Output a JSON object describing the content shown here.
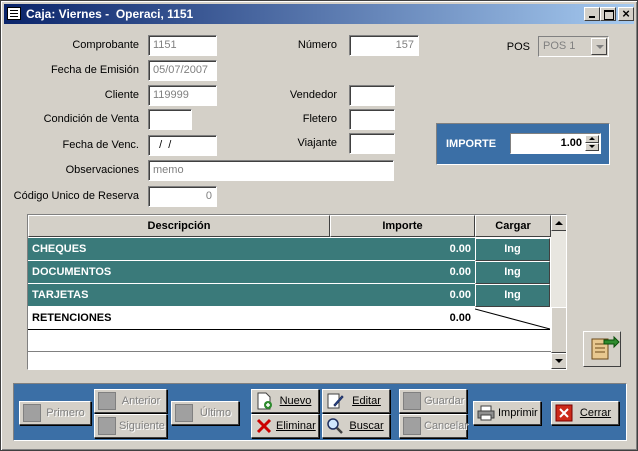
{
  "window": {
    "title": "Caja: Viernes -  Operaci, 1151"
  },
  "form": {
    "comprobante": {
      "label": "Comprobante",
      "value": "1151"
    },
    "fecha_emision": {
      "label": "Fecha de Emisión",
      "value": "05/07/2007"
    },
    "cliente": {
      "label": "Cliente",
      "value": "119999"
    },
    "condicion_venta": {
      "label": "Condición de Venta",
      "value": ""
    },
    "fecha_venc": {
      "label": "Fecha de Venc.",
      "value": "  /  /"
    },
    "observaciones": {
      "label": "Observaciones",
      "value": "memo"
    },
    "codigo_reserva": {
      "label": "Código Unico de Reserva",
      "value": "0"
    },
    "numero": {
      "label": "Número",
      "value": "157"
    },
    "vendedor": {
      "label": "Vendedor",
      "value": ""
    },
    "fletero": {
      "label": "Fletero",
      "value": ""
    },
    "viajante": {
      "label": "Viajante",
      "value": ""
    },
    "pos": {
      "label": "POS",
      "value": "POS 1"
    },
    "importe": {
      "label": "IMPORTE",
      "value": "1.00"
    }
  },
  "grid": {
    "columns": [
      "Descripción",
      "Importe",
      "Cargar"
    ],
    "rows": [
      {
        "descripcion": "CHEQUES",
        "importe": "0.00",
        "cargar": "Ing"
      },
      {
        "descripcion": "DOCUMENTOS",
        "importe": "0.00",
        "cargar": "Ing"
      },
      {
        "descripcion": "TARJETAS",
        "importe": "0.00",
        "cargar": "Ing"
      },
      {
        "descripcion": "RETENCIONES",
        "importe": "0.00",
        "cargar": ""
      }
    ]
  },
  "buttons": {
    "primero": "Primero",
    "anterior": "Anterior",
    "siguiente": "Siguiente",
    "ultimo": "Último",
    "nuevo": "Nuevo",
    "eliminar": "Eliminar",
    "editar": "Editar",
    "buscar": "Buscar",
    "guardar": "Guardar",
    "cancelar": "Cancelar",
    "imprimir": "Imprimir",
    "cerrar": "Cerrar"
  },
  "colors": {
    "title_gradient_start": "#0a246a",
    "panel_blue": "#3b6fa6",
    "grid_teal": "#3a7a7a",
    "face": "#d4d0c8"
  }
}
